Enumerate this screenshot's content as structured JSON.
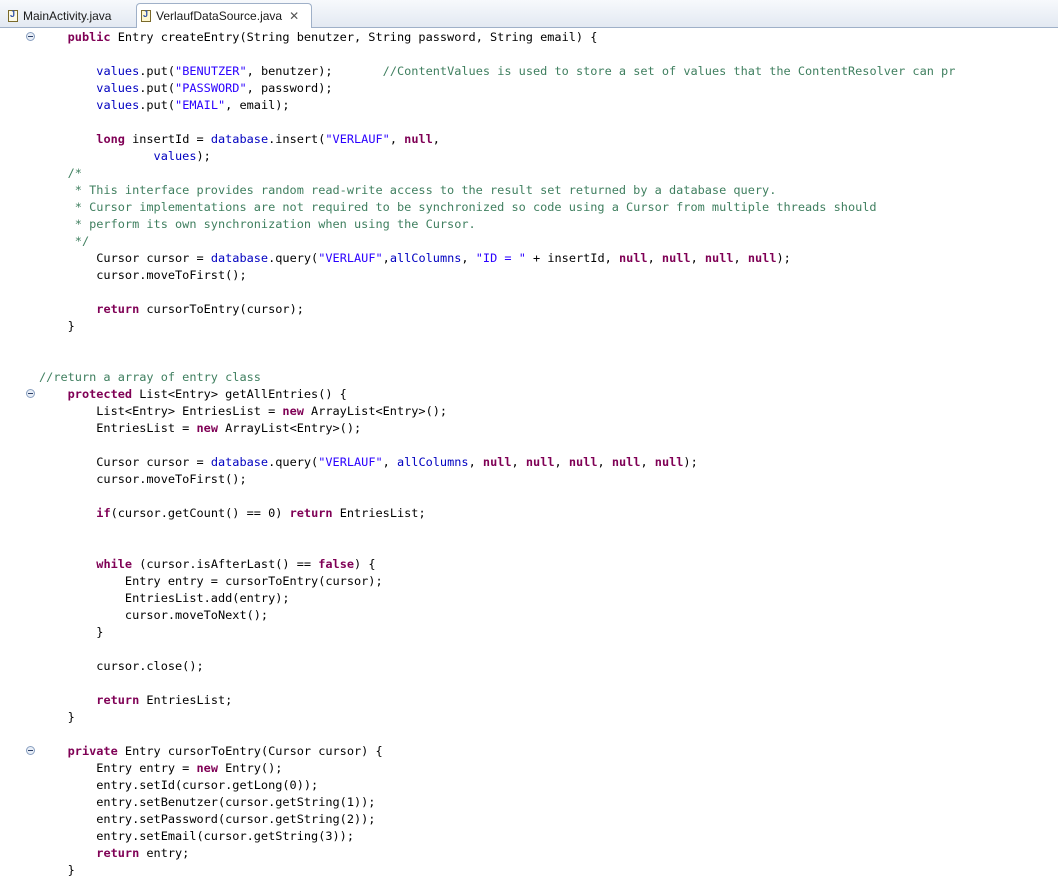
{
  "tabs": [
    {
      "label": "MainActivity.java",
      "active": false
    },
    {
      "label": "VerlaufDataSource.java",
      "active": true
    }
  ],
  "colors": {
    "keyword": "#7f0055",
    "string": "#2a00ff",
    "field": "#0000c0",
    "comment": "#3f7f5f",
    "javadoc": "#3f5fbf"
  },
  "icons": {
    "tab_file": "java-file-icon",
    "tab_close": "close-icon",
    "fold": "fold-collapse-icon"
  },
  "code_lines": [
    [
      [
        "    ",
        ""
      ],
      [
        "public",
        "kw"
      ],
      [
        " Entry createEntry(String benutzer, String password, String email) {",
        ""
      ]
    ],
    [],
    [
      [
        "        ",
        ""
      ],
      [
        "values",
        "fld"
      ],
      [
        ".put(",
        ""
      ],
      [
        "\"BENUTZER\"",
        "str"
      ],
      [
        ", benutzer);       ",
        ""
      ],
      [
        "//ContentValues is used to store a set of values that the ContentResolver can pr",
        "cmt"
      ]
    ],
    [
      [
        "        ",
        ""
      ],
      [
        "values",
        "fld"
      ],
      [
        ".put(",
        ""
      ],
      [
        "\"PASSWORD\"",
        "str"
      ],
      [
        ", password);",
        ""
      ]
    ],
    [
      [
        "        ",
        ""
      ],
      [
        "values",
        "fld"
      ],
      [
        ".put(",
        ""
      ],
      [
        "\"EMAIL\"",
        "str"
      ],
      [
        ", email);",
        ""
      ]
    ],
    [],
    [
      [
        "        ",
        ""
      ],
      [
        "long",
        "kw"
      ],
      [
        " insertId = ",
        ""
      ],
      [
        "database",
        "fld"
      ],
      [
        ".insert(",
        ""
      ],
      [
        "\"VERLAUF\"",
        "str"
      ],
      [
        ", ",
        ""
      ],
      [
        "null",
        "kw"
      ],
      [
        ",",
        ""
      ]
    ],
    [
      [
        "                ",
        ""
      ],
      [
        "values",
        "fld"
      ],
      [
        ");",
        ""
      ]
    ],
    [
      [
        "    /*",
        "cmt"
      ]
    ],
    [
      [
        "     * This interface provides random read-write access to the result set returned by a database query.",
        "cmt"
      ]
    ],
    [
      [
        "     * Cursor implementations are not required to be synchronized so code using a Cursor from multiple threads should",
        "cmt"
      ]
    ],
    [
      [
        "     * perform its own synchronization when using the Cursor.",
        "cmt"
      ]
    ],
    [
      [
        "     */",
        "cmt"
      ]
    ],
    [
      [
        "        Cursor cursor = ",
        ""
      ],
      [
        "database",
        "fld"
      ],
      [
        ".query(",
        ""
      ],
      [
        "\"VERLAUF\"",
        "str"
      ],
      [
        ",",
        ""
      ],
      [
        "allColumns",
        "fld"
      ],
      [
        ", ",
        ""
      ],
      [
        "\"ID = \"",
        "str"
      ],
      [
        " + insertId, ",
        ""
      ],
      [
        "null",
        "kw"
      ],
      [
        ", ",
        ""
      ],
      [
        "null",
        "kw"
      ],
      [
        ", ",
        ""
      ],
      [
        "null",
        "kw"
      ],
      [
        ", ",
        ""
      ],
      [
        "null",
        "kw"
      ],
      [
        ");",
        ""
      ]
    ],
    [
      [
        "        cursor.moveToFirst();",
        ""
      ]
    ],
    [],
    [
      [
        "        ",
        ""
      ],
      [
        "return",
        "kw"
      ],
      [
        " cursorToEntry(cursor);",
        ""
      ]
    ],
    [
      [
        "    }",
        ""
      ]
    ],
    [],
    [],
    [
      [
        "//return a array of entry class",
        "cmt"
      ]
    ],
    [
      [
        "    ",
        ""
      ],
      [
        "protected",
        "kw"
      ],
      [
        " List<Entry> getAllEntries() {",
        ""
      ]
    ],
    [
      [
        "        List<Entry> EntriesList = ",
        ""
      ],
      [
        "new",
        "kw"
      ],
      [
        " ArrayList<Entry>();",
        ""
      ]
    ],
    [
      [
        "        EntriesList = ",
        ""
      ],
      [
        "new",
        "kw"
      ],
      [
        " ArrayList<Entry>();",
        ""
      ]
    ],
    [],
    [
      [
        "        Cursor cursor = ",
        ""
      ],
      [
        "database",
        "fld"
      ],
      [
        ".query(",
        ""
      ],
      [
        "\"VERLAUF\"",
        "str"
      ],
      [
        ", ",
        ""
      ],
      [
        "allColumns",
        "fld"
      ],
      [
        ", ",
        ""
      ],
      [
        "null",
        "kw"
      ],
      [
        ", ",
        ""
      ],
      [
        "null",
        "kw"
      ],
      [
        ", ",
        ""
      ],
      [
        "null",
        "kw"
      ],
      [
        ", ",
        ""
      ],
      [
        "null",
        "kw"
      ],
      [
        ", ",
        ""
      ],
      [
        "null",
        "kw"
      ],
      [
        ");",
        ""
      ]
    ],
    [
      [
        "        cursor.moveToFirst();",
        ""
      ]
    ],
    [],
    [
      [
        "        ",
        ""
      ],
      [
        "if",
        "kw"
      ],
      [
        "(cursor.getCount() == 0) ",
        ""
      ],
      [
        "return",
        "kw"
      ],
      [
        " EntriesList;",
        ""
      ]
    ],
    [],
    [],
    [
      [
        "        ",
        ""
      ],
      [
        "while",
        "kw"
      ],
      [
        " (cursor.isAfterLast() == ",
        ""
      ],
      [
        "false",
        "kw"
      ],
      [
        ") {",
        ""
      ]
    ],
    [
      [
        "            Entry entry = cursorToEntry(cursor);",
        ""
      ]
    ],
    [
      [
        "            EntriesList.add(entry);",
        ""
      ]
    ],
    [
      [
        "            cursor.moveToNext();",
        ""
      ]
    ],
    [
      [
        "        }",
        ""
      ]
    ],
    [],
    [
      [
        "        cursor.close();",
        ""
      ]
    ],
    [],
    [
      [
        "        ",
        ""
      ],
      [
        "return",
        "kw"
      ],
      [
        " EntriesList;",
        ""
      ]
    ],
    [
      [
        "    }",
        ""
      ]
    ],
    [],
    [
      [
        "    ",
        ""
      ],
      [
        "private",
        "kw"
      ],
      [
        " Entry cursorToEntry(Cursor cursor) {",
        ""
      ]
    ],
    [
      [
        "        Entry entry = ",
        ""
      ],
      [
        "new",
        "kw"
      ],
      [
        " Entry();",
        ""
      ]
    ],
    [
      [
        "        entry.setId(cursor.getLong(0));",
        ""
      ]
    ],
    [
      [
        "        entry.setBenutzer(cursor.getString(1));",
        ""
      ]
    ],
    [
      [
        "        entry.setPassword(cursor.getString(2));",
        ""
      ]
    ],
    [
      [
        "        entry.setEmail(cursor.getString(3));",
        ""
      ]
    ],
    [
      [
        "        ",
        ""
      ],
      [
        "return",
        "kw"
      ],
      [
        " entry;",
        ""
      ]
    ],
    [
      [
        "    }",
        ""
      ]
    ]
  ]
}
